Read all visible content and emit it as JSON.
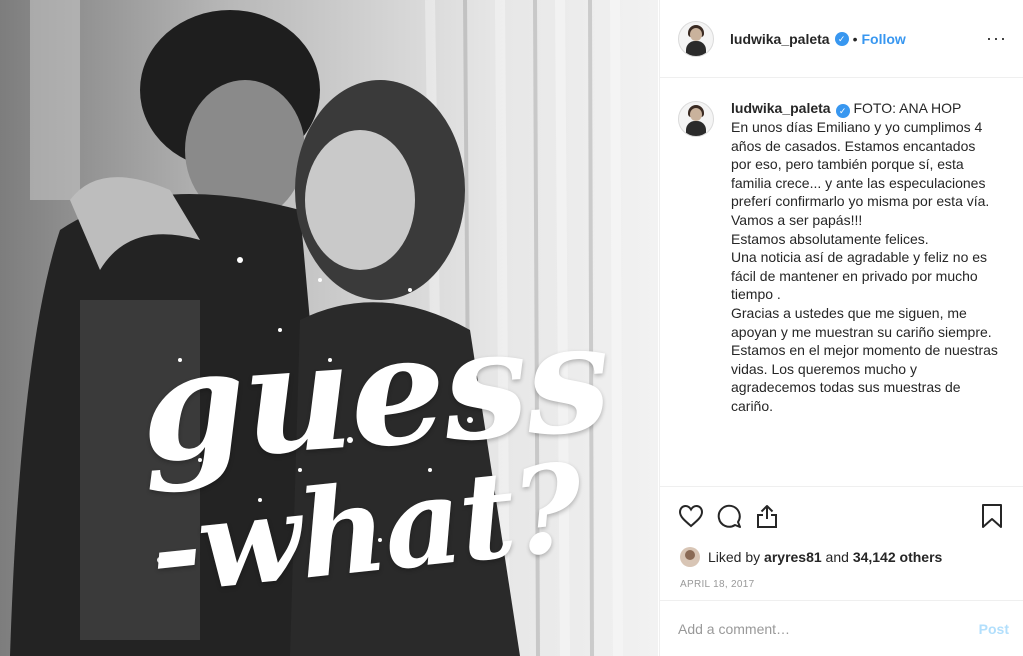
{
  "photo": {
    "overlay_line1": "guess",
    "overlay_line2": "-what?"
  },
  "header": {
    "username": "ludwika_paleta",
    "verified_icon": "verified-badge-icon",
    "separator": "•",
    "follow_label": "Follow",
    "more_icon": "···"
  },
  "caption": {
    "username": "ludwika_paleta",
    "text": "FOTO: ANA HOP\nEn unos días Emiliano y yo cumplimos 4 años de casados. Estamos encantados por eso, pero también porque sí, esta familia crece... y ante las especulaciones preferí confirmarlo yo misma por esta vía. Vamos a ser papás!!!\nEstamos absolutamente felices.\nUna noticia así de agradable y feliz no es fácil de mantener en privado por mucho tiempo .\nGracias a ustedes que me siguen, me apoyan y me muestran su cariño siempre.\nEstamos en el mejor momento de nuestras vidas. Los queremos mucho y agradecemos todas sus muestras de cariño."
  },
  "actions": {
    "like_icon": "heart-icon",
    "comment_icon": "comment-bubble-icon",
    "share_icon": "share-upload-icon",
    "save_icon": "bookmark-icon"
  },
  "likes": {
    "prefix": "Liked by ",
    "user": "aryres81",
    "middle": " and ",
    "count": "34,142 others"
  },
  "date": "APRIL 18, 2017",
  "comment_box": {
    "placeholder": "Add a comment…",
    "post_label": "Post"
  },
  "colors": {
    "accent": "#3897f0",
    "post_disabled": "#b2dffc",
    "muted": "#999999",
    "border": "#efefef"
  }
}
